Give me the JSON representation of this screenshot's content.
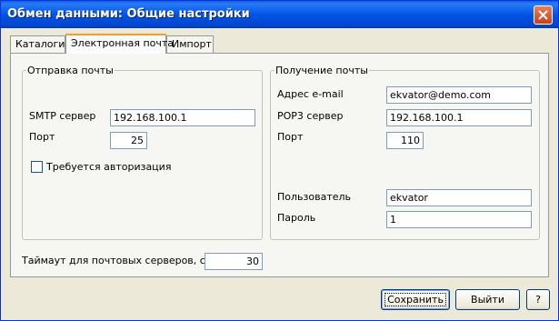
{
  "window": {
    "title": "Обмен данными: Общие настройки"
  },
  "tabs": [
    {
      "label": "Каталоги",
      "active": false
    },
    {
      "label": "Электронная почта",
      "active": true
    },
    {
      "label": "Импорт",
      "active": false
    }
  ],
  "send_group": {
    "title": "Отправка почты",
    "smtp_label": "SMTP сервер",
    "smtp_value": "192.168.100.1",
    "port_label": "Порт",
    "port_value": "25",
    "auth_label": "Требуется авторизация",
    "auth_checked": false
  },
  "receive_group": {
    "title": "Получение почты",
    "email_label": "Адрес e-mail",
    "email_value": "ekvator@demo.com",
    "pop3_label": "POP3 сервер",
    "pop3_value": "192.168.100.1",
    "port_label": "Порт",
    "port_value": "110",
    "user_label": "Пользователь",
    "user_value": "ekvator",
    "password_label": "Пароль",
    "password_value": "1"
  },
  "timeout": {
    "label": "Таймаут для почтовых серверов, сек",
    "value": "30"
  },
  "buttons": {
    "save": "Сохранить",
    "exit": "Выйти",
    "help": "?"
  },
  "colors": {
    "titlebar": "#0055e5",
    "face": "#ece9d8",
    "tab_highlight": "#ff9e1c"
  }
}
